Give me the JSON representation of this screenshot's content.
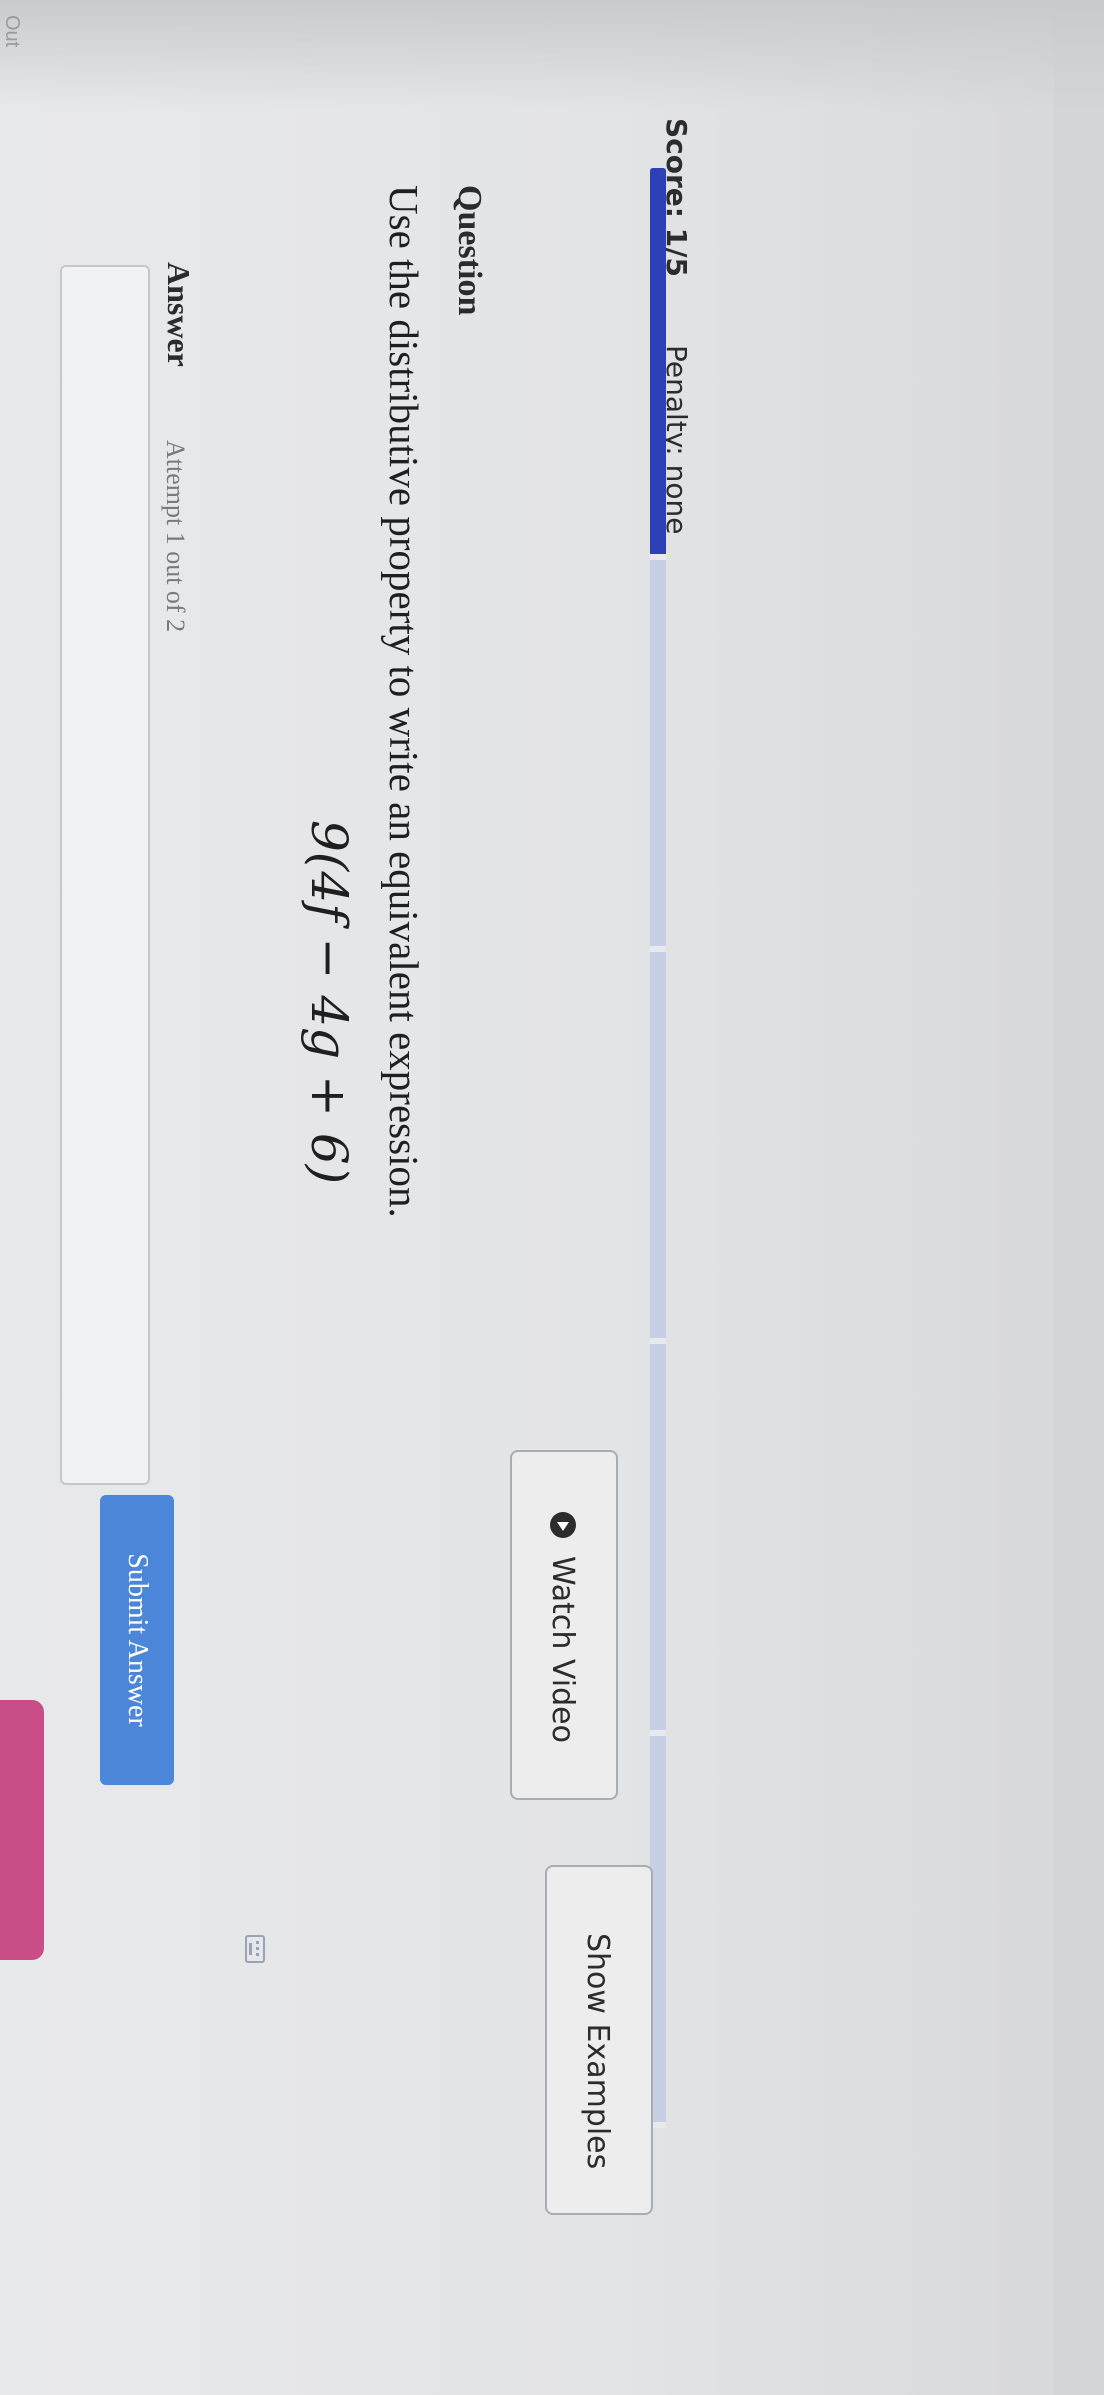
{
  "header": {
    "score": "Score: 1/5",
    "penalty": "Penalty: none",
    "partial_label": "Out"
  },
  "progress": {
    "completed_fraction": 0.2,
    "segments": 5
  },
  "question": {
    "label": "Question",
    "prompt": "Use the distributive property to write an equivalent expression.",
    "expression": "9(4f − 4g + 6)"
  },
  "toolbar": {
    "watch_video_label": "Watch Video",
    "show_examples_label": "Show Examples"
  },
  "answer": {
    "label": "Answer",
    "attempt": "Attempt 1 out of 2",
    "value": "",
    "submit_label": "Submit Answer"
  },
  "colors": {
    "progress_fill": "#2f3fb8",
    "progress_track": "#c7cfe4",
    "submit_bg": "#4c86d8",
    "pink_tab": "#c94d86"
  }
}
